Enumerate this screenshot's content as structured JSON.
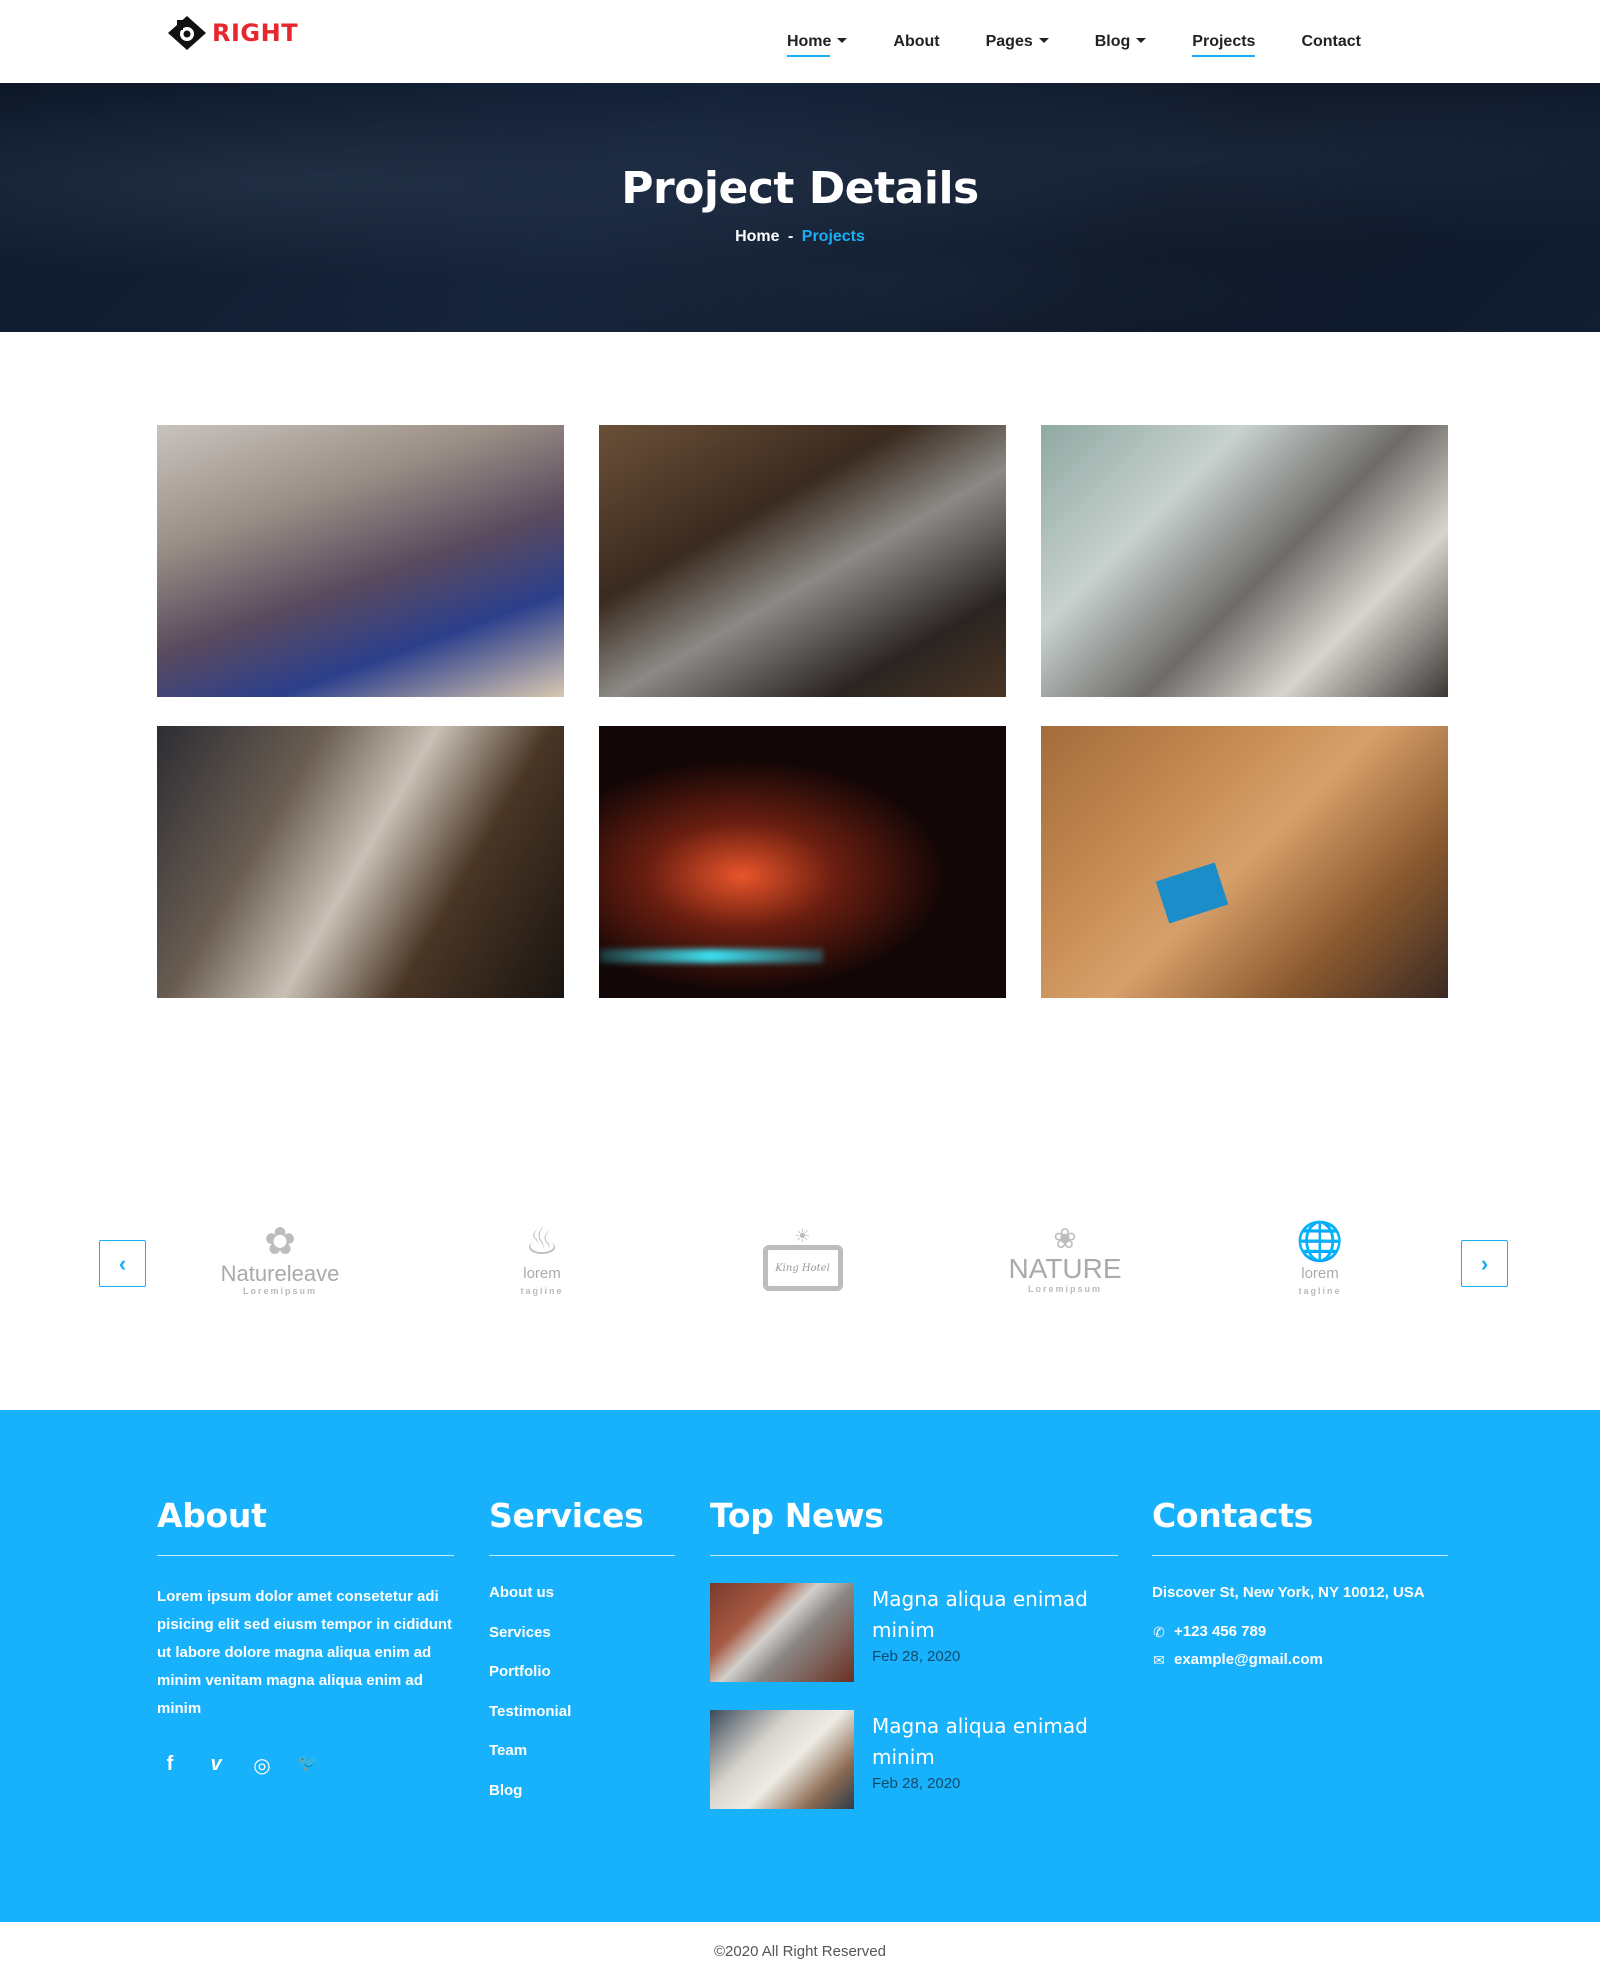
{
  "brand": {
    "name": "RIGHT",
    "accent": "#18aef5",
    "logo_color": "#e8262d",
    "footer_bg": "#18b1fb"
  },
  "nav": {
    "items": [
      {
        "label": "Home",
        "dropdown": true,
        "active": true
      },
      {
        "label": "About",
        "dropdown": false,
        "active": false
      },
      {
        "label": "Pages",
        "dropdown": true,
        "active": false
      },
      {
        "label": "Blog",
        "dropdown": true,
        "active": false
      },
      {
        "label": "Projects",
        "dropdown": false,
        "active": true
      },
      {
        "label": "Contact",
        "dropdown": false,
        "active": false
      }
    ]
  },
  "hero": {
    "title": "Project Details",
    "breadcrumb": {
      "home": "Home",
      "separator": "-",
      "current": "Projects"
    }
  },
  "gallery": {
    "photos": [
      {
        "subject": "team-meeting-women-laptops"
      },
      {
        "subject": "coworkers-laptops-table"
      },
      {
        "subject": "laptop-hands-paperwork"
      },
      {
        "subject": "meeting-table-notes"
      },
      {
        "subject": "backlit-keyboard"
      },
      {
        "subject": "laptops-desk-overhead"
      }
    ]
  },
  "partners": {
    "prev_icon": "chevron-left-icon",
    "next_icon": "chevron-right-icon",
    "logos": [
      {
        "name": "Natureleave",
        "sub": "Loremipsum"
      },
      {
        "name": "lorem",
        "sub": "tagline"
      },
      {
        "name": "King Hotel",
        "sub": ""
      },
      {
        "name": "NATURE",
        "sub": "Loremipsum"
      },
      {
        "name": "lorem",
        "sub": "tagline"
      }
    ]
  },
  "footer": {
    "about": {
      "heading": "About",
      "text": "Lorem ipsum dolor amet consetetur adi pisicing elit sed eiusm tempor in cididunt ut labore dolore magna aliqua enim ad minim venitam magna aliqua enim ad minim",
      "socials": [
        {
          "icon": "facebook-icon",
          "glyph": "f"
        },
        {
          "icon": "vimeo-icon",
          "glyph": "v"
        },
        {
          "icon": "instagram-icon",
          "glyph": "◎"
        },
        {
          "icon": "twitter-icon",
          "glyph": "🐦"
        }
      ]
    },
    "services": {
      "heading": "Services",
      "links": [
        "About us",
        "Services",
        "Portfolio",
        "Testimonial",
        "Team",
        "Blog"
      ]
    },
    "news": {
      "heading": "Top News",
      "items": [
        {
          "title": "Magna aliqua enimad minim",
          "date": "Feb 28, 2020"
        },
        {
          "title": "Magna aliqua enimad minim",
          "date": "Feb 28, 2020"
        }
      ]
    },
    "contacts": {
      "heading": "Contacts",
      "address": "Discover St, New York, NY 10012, USA",
      "phone": "+123 456 789",
      "email": "example@gmail.com"
    }
  },
  "copyright": "©2020 All Right Reserved"
}
